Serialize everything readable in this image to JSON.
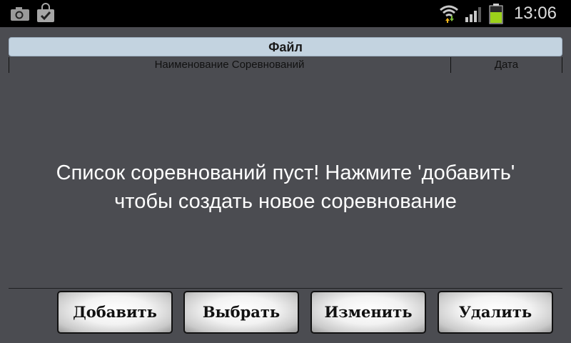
{
  "status_bar": {
    "time": "13:06",
    "icons": [
      "camera-icon",
      "shopping-bag-check-icon",
      "wifi-icon",
      "signal-icon",
      "battery-icon"
    ],
    "battery_color": "#9cd21a"
  },
  "window": {
    "title": "Файл"
  },
  "table": {
    "columns": [
      {
        "label": "Наименование Соревнований"
      },
      {
        "label": "Дата"
      }
    ]
  },
  "empty_state": {
    "line1": "Список соревнований пуст! Нажмите 'добавить'",
    "line2": "чтобы создать новое соревнование"
  },
  "buttons": {
    "add": "Добавить",
    "select": "Выбрать",
    "edit": "Изменить",
    "delete": "Удалить"
  },
  "colors": {
    "background": "#4b4c51",
    "titlebar": "#c3d3e0",
    "status_bar": "#000000"
  }
}
